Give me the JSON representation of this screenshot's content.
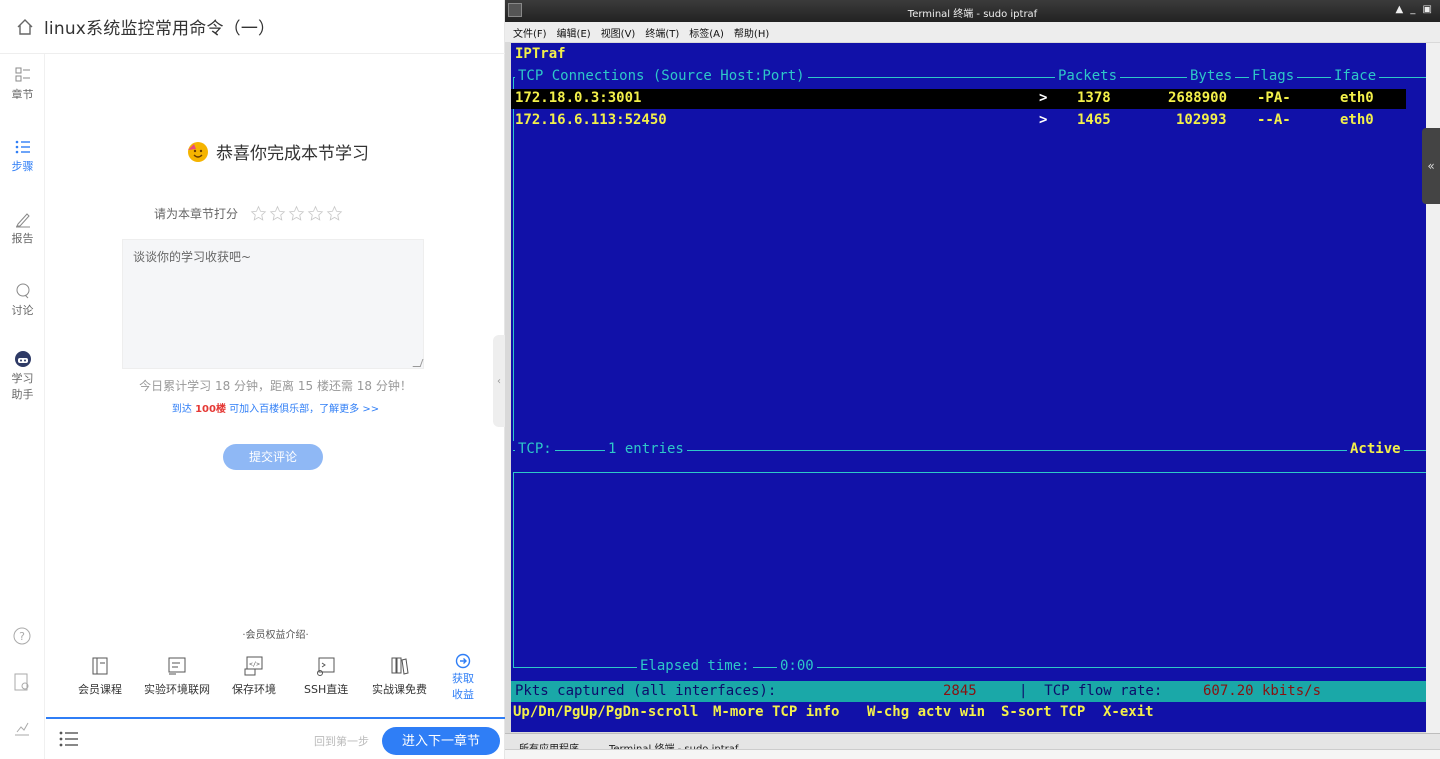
{
  "left": {
    "page_title": "linux系统监控常用命令（一）",
    "nav": [
      {
        "label": "章节",
        "icon": "chapter-icon"
      },
      {
        "label": "步骤",
        "icon": "steps-icon"
      },
      {
        "label": "报告",
        "icon": "report-icon"
      },
      {
        "label": "讨论",
        "icon": "discussion-icon"
      },
      {
        "label": "学习",
        "label2": "助手",
        "icon": "assistant-icon"
      }
    ],
    "congrats": "恭喜你完成本节学习",
    "rate_label": "请为本章节打分",
    "stars": 5,
    "comment_placeholder": "谈谈你的学习收获吧~",
    "stats": "今日累计学习 18 分钟，距离 15 楼还需 18 分钟！",
    "club_prefix": "到达 ",
    "club_highlight": "100楼",
    "club_suffix": " 可加入百楼俱乐部，了解更多 >>",
    "submit": "提交评论",
    "benefits_title": "·会员权益介绍·",
    "benefits": [
      {
        "label": "会员课程",
        "icon": "course-icon"
      },
      {
        "label": "实验环境联网",
        "icon": "network-icon"
      },
      {
        "label": "保存环境",
        "icon": "save-env-icon"
      },
      {
        "label": "SSH直连",
        "icon": "ssh-icon"
      },
      {
        "label": "实战课免费",
        "icon": "books-icon"
      }
    ],
    "get_benefit_1": "获取",
    "get_benefit_2": "收益",
    "prev_step": "回到第一步",
    "next_chapter": "进入下一章节",
    "colors": {
      "accent": "#2f7ef6",
      "highlight": "#e53935"
    }
  },
  "terminal": {
    "window_title": "Terminal 终端 - sudo iptraf",
    "menu": [
      "文件(F)",
      "编辑(E)",
      "视图(V)",
      "终端(T)",
      "标签(A)",
      "帮助(H)"
    ],
    "app_name": "IPTraf",
    "header": {
      "connections": "TCP Connections (Source Host:Port)",
      "packets": "Packets",
      "bytes": "Bytes",
      "flags": "Flags",
      "iface": "Iface"
    },
    "connections": [
      {
        "host": "172.18.0.3:3001",
        "dir": ">",
        "packets": "1378",
        "bytes": "2688900",
        "flags": "-PA-",
        "iface": "eth0",
        "selected": true
      },
      {
        "host": "172.16.6.113:52450",
        "dir": ">",
        "packets": "1465",
        "bytes": "102993",
        "flags": "--A-",
        "iface": "eth0",
        "selected": false
      }
    ],
    "tcp_label": "TCP:",
    "tcp_entries": "1 entries",
    "active": "Active",
    "elapsed": "Elapsed time:",
    "elapsed_value": "0:00",
    "pkts_label": "Pkts captured (all interfaces):",
    "pkts_value": "2845",
    "flow_label": "|  TCP flow rate:",
    "flow_value": "607.20 kbits/s",
    "help": [
      "Up/Dn/PgUp/PgDn-scroll",
      "M-more TCP info",
      "W-chg actv win",
      "S-sort TCP",
      "X-exit"
    ],
    "taskbar_apps": "所有应用程序",
    "taskbar_task": "Terminal 终端 - sudo iptraf",
    "colors": {
      "bg": "#1111a8",
      "fg": "#2ec8c8",
      "highlight": "#f3f04a",
      "status": "#1aa8a8"
    }
  }
}
